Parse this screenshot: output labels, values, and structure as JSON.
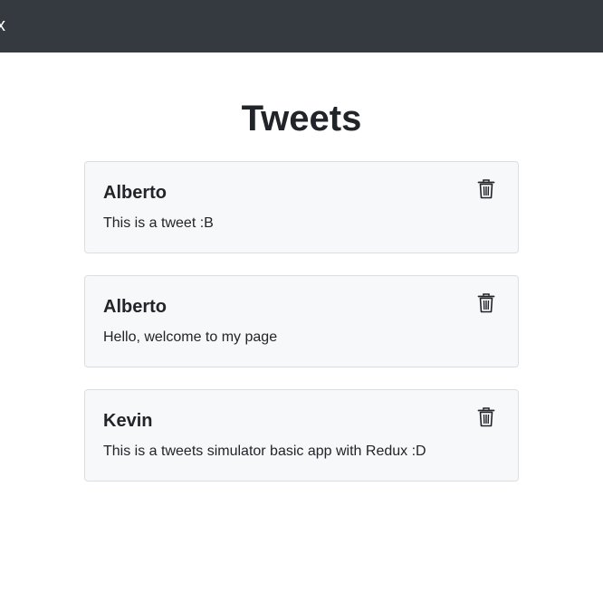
{
  "navbar": {
    "brand": "x"
  },
  "page": {
    "title": "Tweets"
  },
  "tweets": [
    {
      "author": "Alberto",
      "text": "This is a tweet :B",
      "delete_icon": "trash-icon"
    },
    {
      "author": "Alberto",
      "text": "Hello, welcome to my page",
      "delete_icon": "trash-icon"
    },
    {
      "author": "Kevin",
      "text": "This is a tweets simulator basic app with Redux :D",
      "delete_icon": "trash-icon"
    }
  ],
  "colors": {
    "navbar_bg": "#343a40",
    "card_bg": "#f7f8f9",
    "card_border": "#dcdfe2",
    "text": "#212529"
  }
}
